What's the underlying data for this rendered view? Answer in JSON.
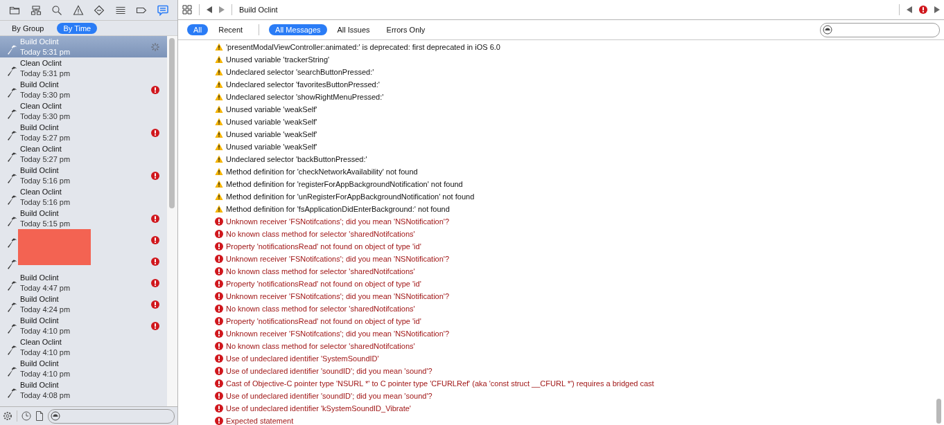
{
  "navigator": {
    "tabs": [
      {
        "kind": "folder",
        "selected": false
      },
      {
        "kind": "hierarchy",
        "selected": false
      },
      {
        "kind": "search",
        "selected": false
      },
      {
        "kind": "warning",
        "selected": false
      },
      {
        "kind": "breakpoint",
        "selected": false
      },
      {
        "kind": "list",
        "selected": false
      },
      {
        "kind": "tag",
        "selected": false
      },
      {
        "kind": "chat",
        "selected": true
      }
    ]
  },
  "grouping": [
    {
      "label": "By Group",
      "selected": false
    },
    {
      "label": "By Time",
      "selected": true
    }
  ],
  "builds": [
    {
      "title": "Build Oclint",
      "time": "Today 5:31 pm",
      "selected": true,
      "in_progress": true,
      "failed": false
    },
    {
      "title": "Clean Oclint",
      "time": "Today 5:31 pm",
      "selected": false,
      "in_progress": false,
      "failed": false
    },
    {
      "title": "Build Oclint",
      "time": "Today 5:30 pm",
      "selected": false,
      "in_progress": false,
      "failed": true
    },
    {
      "title": "Clean Oclint",
      "time": "Today 5:30 pm",
      "selected": false,
      "in_progress": false,
      "failed": false
    },
    {
      "title": "Build Oclint",
      "time": "Today 5:27 pm",
      "selected": false,
      "in_progress": false,
      "failed": true
    },
    {
      "title": "Clean Oclint",
      "time": "Today 5:27 pm",
      "selected": false,
      "in_progress": false,
      "failed": false
    },
    {
      "title": "Build Oclint",
      "time": "Today 5:16 pm",
      "selected": false,
      "in_progress": false,
      "failed": true
    },
    {
      "title": "Clean Oclint",
      "time": "Today 5:16 pm",
      "selected": false,
      "in_progress": false,
      "failed": false
    },
    {
      "title": "Build Oclint",
      "time": "Today 5:15 pm",
      "selected": false,
      "in_progress": false,
      "failed": true
    },
    {
      "selected": false,
      "in_progress": false,
      "failed": true
    },
    {
      "selected": false,
      "in_progress": false,
      "failed": true
    },
    {
      "title": "Build Oclint",
      "time": "Today 4:47 pm",
      "selected": false,
      "in_progress": false,
      "failed": true
    },
    {
      "title": "Build Oclint",
      "time": "Today 4:24 pm",
      "selected": false,
      "in_progress": false,
      "failed": true
    },
    {
      "title": "Build Oclint",
      "time": "Today 4:10 pm",
      "selected": false,
      "in_progress": false,
      "failed": true
    },
    {
      "title": "Clean Oclint",
      "time": "Today 4:10 pm",
      "selected": false,
      "in_progress": false,
      "failed": false
    },
    {
      "title": "Build Oclint",
      "time": "Today 4:10 pm",
      "selected": false,
      "in_progress": false,
      "failed": false
    },
    {
      "title": "Build Oclint",
      "time": "Today 4:08 pm",
      "selected": false,
      "in_progress": false,
      "failed": false
    }
  ],
  "redaction": true,
  "title": "Build Oclint",
  "scope_filters": [
    {
      "label": "All",
      "selected": true
    },
    {
      "label": "Recent",
      "selected": false
    }
  ],
  "message_filters": [
    {
      "label": "All Messages",
      "selected": true
    },
    {
      "label": "All Issues",
      "selected": false
    },
    {
      "label": "Errors Only",
      "selected": false
    }
  ],
  "messages": [
    {
      "kind": "warning",
      "text": "'presentModalViewController:animated:' is deprecated: first deprecated in iOS 6.0"
    },
    {
      "kind": "warning",
      "text": "Unused variable 'trackerString'"
    },
    {
      "kind": "warning",
      "text": "Undeclared selector 'searchButtonPressed:'"
    },
    {
      "kind": "warning",
      "text": "Undeclared selector 'favoritesButtonPressed:'"
    },
    {
      "kind": "warning",
      "text": "Undeclared selector 'showRightMenuPressed:'"
    },
    {
      "kind": "warning",
      "text": "Unused variable 'weakSelf'"
    },
    {
      "kind": "warning",
      "text": "Unused variable 'weakSelf'"
    },
    {
      "kind": "warning",
      "text": "Unused variable 'weakSelf'"
    },
    {
      "kind": "warning",
      "text": "Unused variable 'weakSelf'"
    },
    {
      "kind": "warning",
      "text": "Undeclared selector 'backButtonPressed:'"
    },
    {
      "kind": "warning",
      "text": "Method definition for 'checkNetworkAvailability' not found"
    },
    {
      "kind": "warning",
      "text": "Method definition for 'registerForAppBackgroundNotification' not found"
    },
    {
      "kind": "warning",
      "text": "Method definition for 'unRegisterForAppBackgroundNotification' not found"
    },
    {
      "kind": "warning",
      "text": "Method definition for 'fsApplicationDidEnterBackground:' not found"
    },
    {
      "kind": "error",
      "text": "Unknown receiver 'FSNotifcations'; did you mean 'NSNotification'?"
    },
    {
      "kind": "error",
      "text": "No known class method for selector 'sharedNotifcations'"
    },
    {
      "kind": "error",
      "text": "Property 'notificationsRead' not found on object of type 'id'"
    },
    {
      "kind": "error",
      "text": "Unknown receiver 'FSNotifcations'; did you mean 'NSNotification'?"
    },
    {
      "kind": "error",
      "text": "No known class method for selector 'sharedNotifcations'"
    },
    {
      "kind": "error",
      "text": "Property 'notificationsRead' not found on object of type 'id'"
    },
    {
      "kind": "error",
      "text": "Unknown receiver 'FSNotifcations'; did you mean 'NSNotification'?"
    },
    {
      "kind": "error",
      "text": "No known class method for selector 'sharedNotifcations'"
    },
    {
      "kind": "error",
      "text": "Property 'notificationsRead' not found on object of type 'id'"
    },
    {
      "kind": "error",
      "text": "Unknown receiver 'FSNotifcations'; did you mean 'NSNotification'?"
    },
    {
      "kind": "error",
      "text": "No known class method for selector 'sharedNotifcations'"
    },
    {
      "kind": "error",
      "text": "Use of undeclared identifier 'SystemSoundID'"
    },
    {
      "kind": "error",
      "text": "Use of undeclared identifier 'soundID'; did you mean 'sound'?"
    },
    {
      "kind": "error",
      "text": "Cast of Objective-C pointer type 'NSURL *' to C pointer type 'CFURLRef' (aka 'const struct __CFURL *') requires a bridged cast"
    },
    {
      "kind": "error",
      "text": "Use of undeclared identifier 'soundID'; did you mean 'sound'?"
    },
    {
      "kind": "error",
      "text": "Use of undeclared identifier 'kSystemSoundID_Vibrate'"
    },
    {
      "kind": "error",
      "text": "Expected statement"
    }
  ]
}
